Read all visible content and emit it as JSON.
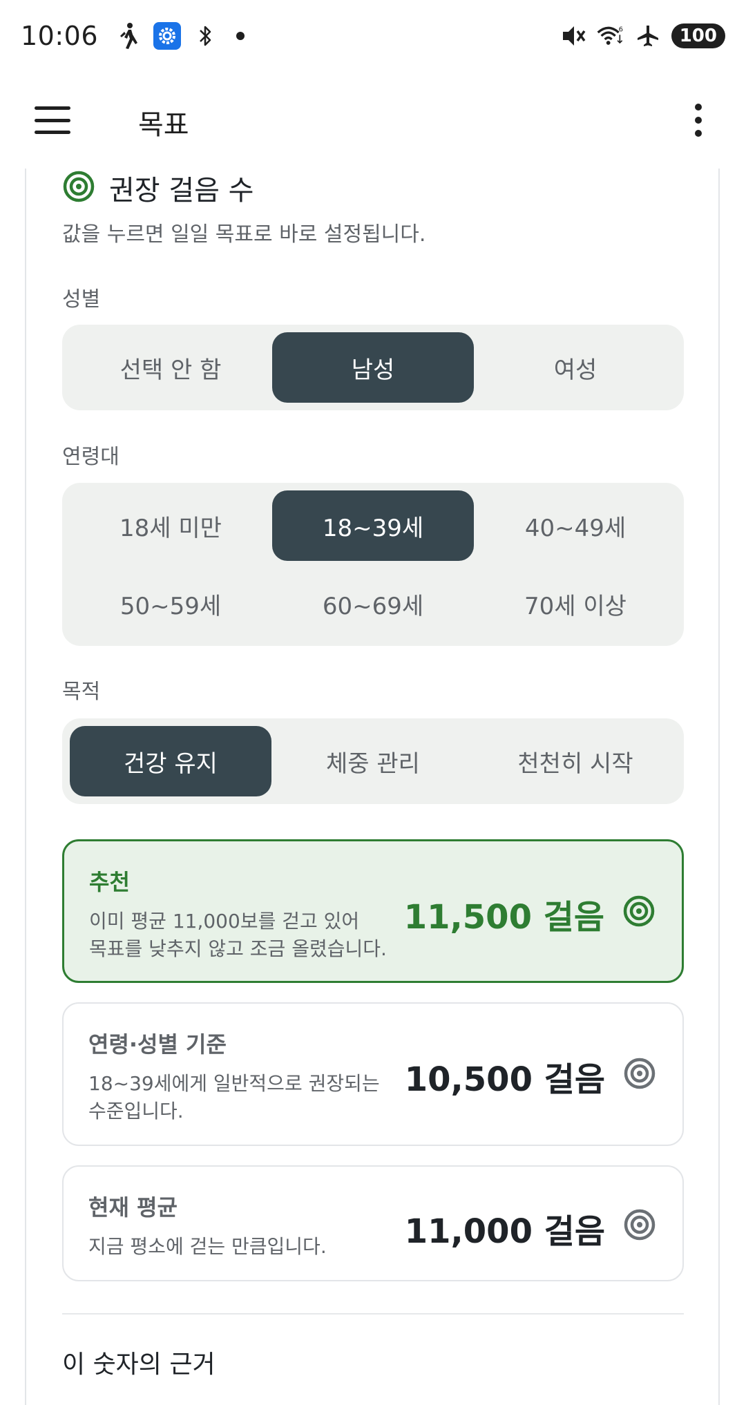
{
  "status_bar": {
    "time": "10:06",
    "battery": "100",
    "icons": [
      "walk-icon",
      "settings-icon",
      "bluetooth-icon",
      "dot-icon",
      "vibrate-off-icon",
      "wifi-icon",
      "airplane-icon"
    ]
  },
  "app_bar": {
    "title": "목표"
  },
  "section": {
    "title": "권장 걸음 수",
    "description": "값을 누르면 일일 목표로 바로 설정됩니다."
  },
  "gender": {
    "label": "성별",
    "options": [
      "선택 안 함",
      "남성",
      "여성"
    ],
    "selected": "남성"
  },
  "age": {
    "label": "연령대",
    "options": [
      "18세 미만",
      "18~39세",
      "40~49세",
      "50~59세",
      "60~69세",
      "70세 이상"
    ],
    "selected": "18~39세"
  },
  "purpose": {
    "label": "목적",
    "options": [
      "건강 유지",
      "체중 관리",
      "천천히 시작"
    ],
    "selected": "건강 유지"
  },
  "cards": [
    {
      "title": "추천",
      "description_line1": "이미 평균 11,000보를 걷고 있어",
      "description_line2": "목표를 낮추지 않고 조금 올렸습니다.",
      "value": "11,500 걸음"
    },
    {
      "title": "연령·성별 기준",
      "description_line1": "18~39세에게 일반적으로 권장되는",
      "description_line2": "수준입니다.",
      "value": "10,500 걸음"
    },
    {
      "title": "현재 평균",
      "description_line1": "지금 평소에 걷는 만큼입니다.",
      "value": "11,000 걸음"
    }
  ],
  "basis": {
    "title": "이 숫자의 근거"
  },
  "colors": {
    "accent_green": "#2e7d32",
    "recommended_bg": "#e8f2e8",
    "selected_segment": "#37474f",
    "segment_bg": "#eff1ef"
  }
}
